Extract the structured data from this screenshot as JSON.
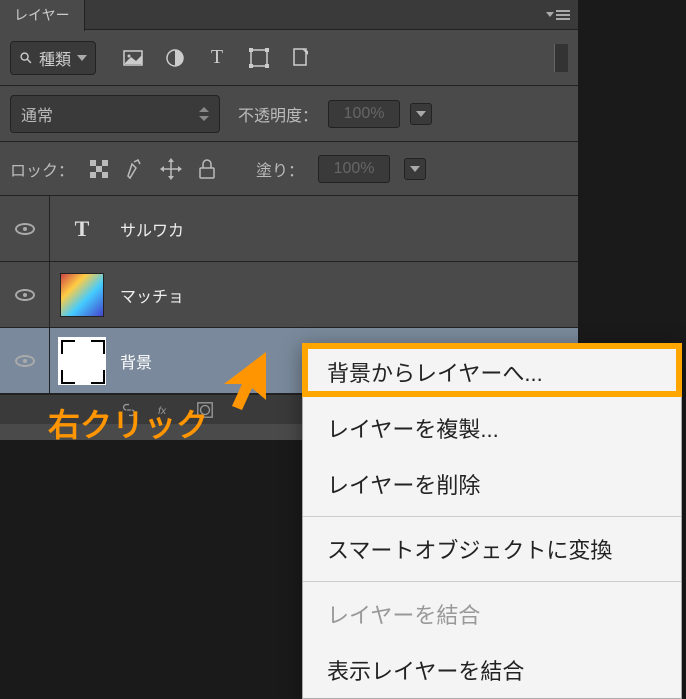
{
  "panel": {
    "tab_title": "レイヤー"
  },
  "filter": {
    "type_label": "種類"
  },
  "blend": {
    "mode": "通常",
    "opacity_label": "不透明度：",
    "opacity_value": "100%"
  },
  "lock": {
    "label": "ロック：",
    "fill_label": "塗り：",
    "fill_value": "100%"
  },
  "layers": [
    {
      "name": "サルワカ",
      "type": "text"
    },
    {
      "name": "マッチョ",
      "type": "image"
    },
    {
      "name": "背景",
      "type": "background",
      "selected": true
    }
  ],
  "context_menu": {
    "items": [
      {
        "label": "背景からレイヤーへ...",
        "enabled": true,
        "highlighted": true
      },
      {
        "label": "レイヤーを複製...",
        "enabled": true
      },
      {
        "label": "レイヤーを削除",
        "enabled": true
      },
      {
        "separator": true
      },
      {
        "label": "スマートオブジェクトに変換",
        "enabled": true
      },
      {
        "separator": true
      },
      {
        "label": "レイヤーを結合",
        "enabled": false
      },
      {
        "label": "表示レイヤーを結合",
        "enabled": true
      }
    ]
  },
  "annotation": {
    "text": "右クリック"
  }
}
